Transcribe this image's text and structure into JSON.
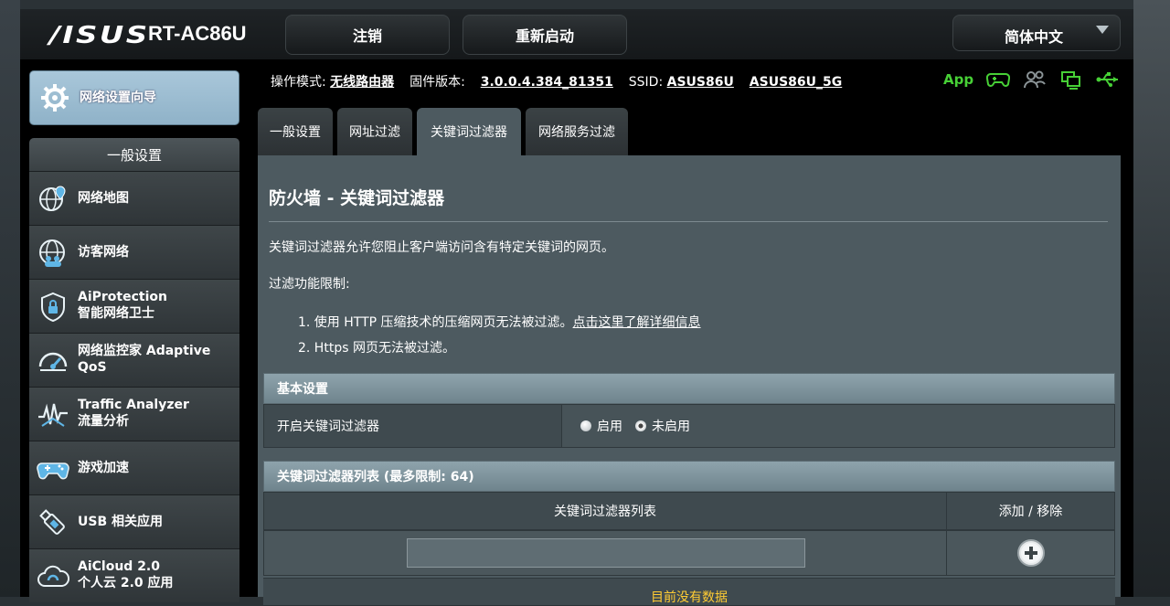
{
  "header": {
    "brand": "/ISUS",
    "model": "RT-AC86U",
    "logout_label": "注销",
    "reboot_label": "重新启动",
    "language": "简体中文"
  },
  "sidebar": {
    "wizard_label": "网络设置向导",
    "section_title": "一般设置",
    "items": [
      {
        "lines": [
          "网络地图"
        ],
        "icon": "globe-pin-icon"
      },
      {
        "lines": [
          "访客网络"
        ],
        "icon": "guest-network-icon"
      },
      {
        "lines": [
          "AiProtection",
          "智能网络卫士"
        ],
        "icon": "shield-lock-icon"
      },
      {
        "lines": [
          "网络监控家 Adaptive",
          "QoS"
        ],
        "icon": "speedometer-icon"
      },
      {
        "lines": [
          "Traffic Analyzer",
          "流量分析"
        ],
        "icon": "traffic-wave-icon"
      },
      {
        "lines": [
          "游戏加速"
        ],
        "icon": "gamepad-icon"
      },
      {
        "lines": [
          "USB 相关应用"
        ],
        "icon": "usb-stick-icon"
      },
      {
        "lines": [
          "AiCloud 2.0",
          "个人云 2.0 应用"
        ],
        "icon": "cloud-icon"
      }
    ]
  },
  "status": {
    "mode_label": "操作模式:",
    "mode_value": "无线路由器",
    "firmware_label": "固件版本:",
    "firmware_value": "3.0.0.4.384_81351",
    "ssid_label": "SSID:",
    "ssid_1": "ASUS86U",
    "ssid_2": "ASUS86U_5G",
    "app_label": "App",
    "icons": [
      "gamepad-status-icon",
      "users-status-icon",
      "network-status-icon",
      "usb-status-icon"
    ],
    "accent_color": "#47d036"
  },
  "tabs": [
    {
      "label": "一般设置",
      "active": false
    },
    {
      "label": "网址过滤",
      "active": false
    },
    {
      "label": "关键词过滤器",
      "active": true
    },
    {
      "label": "网络服务过滤",
      "active": false
    }
  ],
  "content": {
    "title": "防火墙 - 关键词过滤器",
    "description": "关键词过滤器允许您阻止客户端访问含有特定关键词的网页。",
    "limits_label": "过滤功能限制:",
    "limit_1_text": "1. 使用 HTTP 压缩技术的压缩网页无法被过滤。",
    "limit_1_link": "点击这里了解详细信息",
    "limit_2_text": "2. Https 网页无法被过滤。"
  },
  "basic": {
    "header": "基本设置",
    "row_label": "开启关键词过滤器",
    "option_enable": "启用",
    "option_disable": "未启用",
    "selected": "未启用"
  },
  "list": {
    "header": "关键词过滤器列表 (最多限制: 64)",
    "col_keyword": "关键词过滤器列表",
    "col_action": "添加 / 移除",
    "input_value": "",
    "empty_text": "目前没有数据"
  }
}
